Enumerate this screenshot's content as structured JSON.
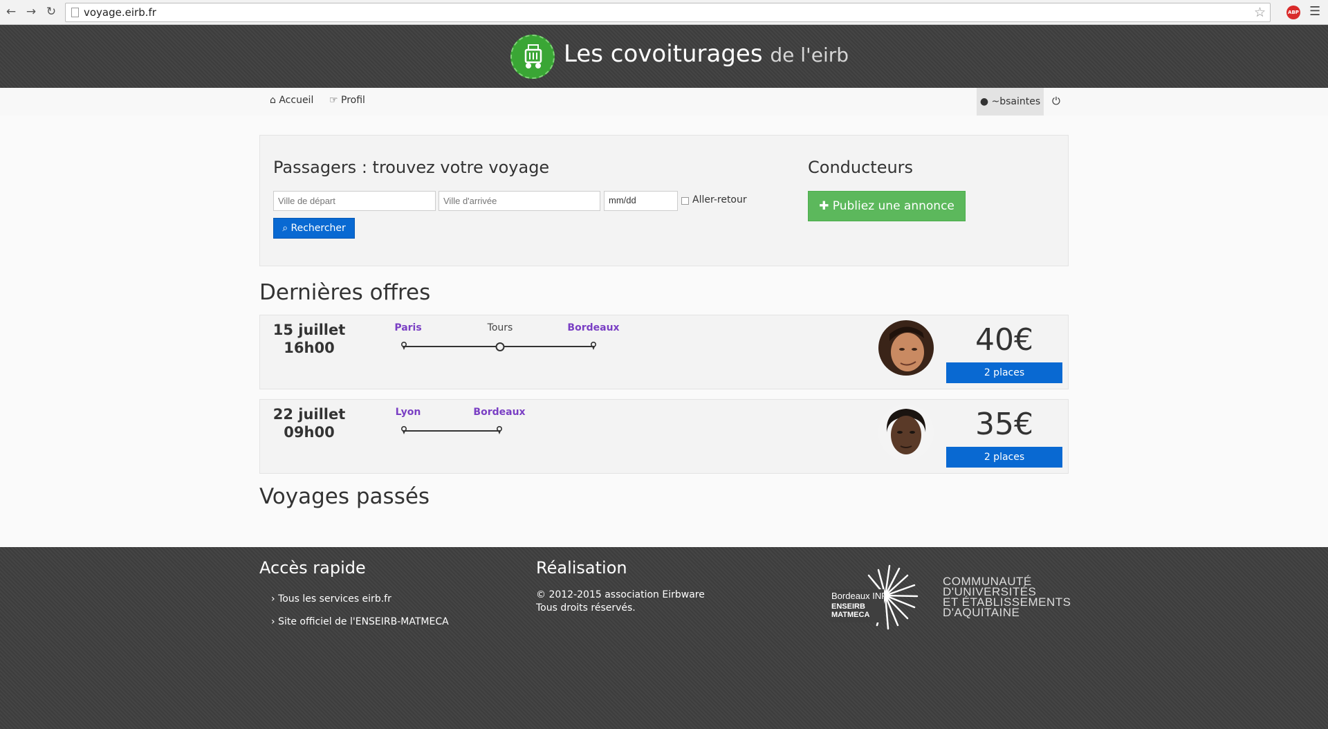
{
  "browser": {
    "url": "voyage.eirb.fr",
    "abp_label": "ABP"
  },
  "header": {
    "title_bold": "Les covoiturages",
    "title_light": "de l'eirb"
  },
  "nav": {
    "home": "Accueil",
    "profile": "Profil",
    "user": "~bsaintes"
  },
  "search": {
    "title": "Passagers : trouvez votre voyage",
    "departure_placeholder": "Ville de départ",
    "arrival_placeholder": "Ville d'arrivée",
    "date_placeholder": "mm/dd",
    "date_display": "mm/dd",
    "roundtrip_label": "Aller-retour",
    "button": "Rechercher"
  },
  "drivers": {
    "title": "Conducteurs",
    "button": "Publiez une annonce"
  },
  "offers_title": "Dernières offres",
  "offers": [
    {
      "date": "15 juillet",
      "time": "16h00",
      "from": "Paris",
      "step": "Tours",
      "to": "Bordeaux",
      "price": "40€",
      "places": "2 places"
    },
    {
      "date": "22 juillet",
      "time": "09h00",
      "from": "Lyon",
      "to": "Bordeaux",
      "price": "35€",
      "places": "2 places"
    }
  ],
  "past_title": "Voyages passés",
  "footer": {
    "quick_title": "Accès rapide",
    "links": [
      "Tous les services eirb.fr",
      "Site officiel de l'ENSEIRB-MATMECA"
    ],
    "credits_title": "Réalisation",
    "credits_line1": "© 2012-2015 association Eirbware",
    "credits_line2": "Tous droits réservés.",
    "inp_logo_line1": "Bordeaux INP",
    "inp_logo_line2": "ENSEIRB",
    "inp_logo_line3": "MATMECA",
    "community_lines": [
      "COMMUNAUTÉ",
      "D'UNIVERSITÉS",
      "ET ÉTABLISSEMENTS",
      "D'AQUITAINE"
    ]
  }
}
